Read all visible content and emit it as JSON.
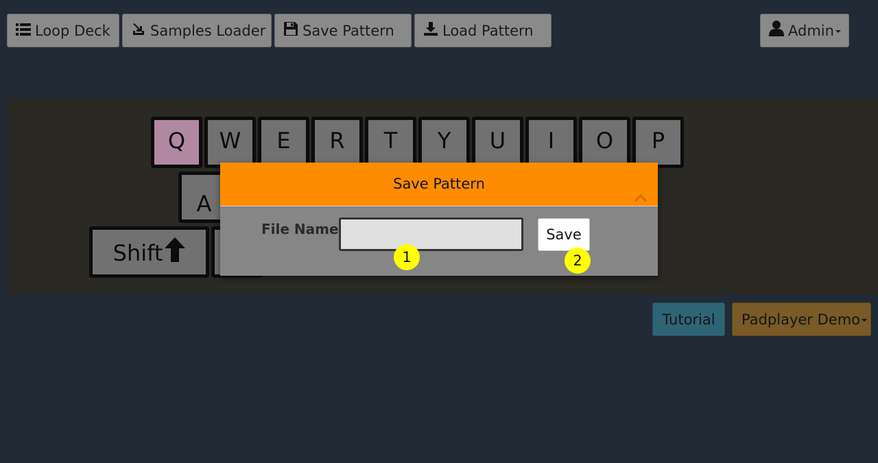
{
  "topnav": {
    "loop_deck": "Loop Deck",
    "samples_loader": "Samples Loader",
    "save_pattern": "Save Pattern",
    "load_pattern": "Load Pattern",
    "admin": "Admin"
  },
  "keyboard": {
    "row1": [
      "Q",
      "W",
      "E",
      "R",
      "T",
      "Y",
      "U",
      "I",
      "O",
      "P"
    ],
    "row2_visible": [
      "A"
    ],
    "shift_label": "Shift",
    "active_key": "Q"
  },
  "modal": {
    "title": "Save Pattern",
    "file_name_label": "File Name:",
    "file_name_value": "",
    "save_label": "Save"
  },
  "annotations": {
    "badge_1": "1",
    "badge_2": "2"
  },
  "bottom": {
    "tutorial": "Tutorial",
    "padplayer_demo": "Padplayer Demo"
  },
  "colors": {
    "page_bg": "#222a35",
    "stage_bg": "#2a2924",
    "nav_button": "#8a8a8a",
    "key": "#717171",
    "key_active": "#b088a1",
    "modal_header": "#ff8c00",
    "modal_body": "#868686",
    "badge": "#ffff00",
    "tutorial_button": "#2f6475",
    "padplayer_button": "#7a5a26"
  },
  "icons": {
    "loop_deck": "list-icon",
    "samples_loader": "import-icon",
    "save_pattern": "floppy-disk-icon",
    "load_pattern": "download-icon",
    "admin": "user-icon",
    "modal_collapse": "chevron-up-icon",
    "shift_arrow": "arrow-up-icon"
  }
}
